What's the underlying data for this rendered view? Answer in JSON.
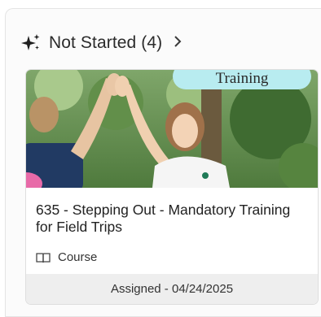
{
  "section": {
    "title": "Not Started (4)",
    "icon": "sparkle-icon",
    "chevron_icon": "chevron-right-icon"
  },
  "card": {
    "tag": "Training",
    "title": "635 - Stepping Out - Mandatory Training for Field Trips",
    "type_icon": "book-icon",
    "type_label": "Course",
    "assigned": "Assigned - 04/24/2025",
    "colors": {
      "tag_bg": "#b8ecf0",
      "footer_bg": "#eeeeee"
    }
  }
}
